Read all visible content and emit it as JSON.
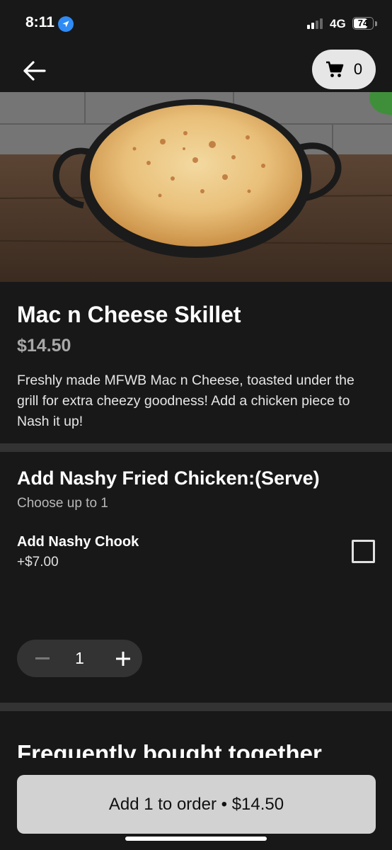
{
  "status": {
    "time": "8:11",
    "network": "4G",
    "battery": "74",
    "battery_level": 0.74
  },
  "header": {
    "back_icon": "arrow-left-icon",
    "cart_icon": "cart-icon",
    "cart_count": "0"
  },
  "product": {
    "image": "mac-n-cheese-skillet-photo",
    "name": "Mac n Cheese Skillet",
    "price": "$14.50",
    "description": "Freshly made MFWB Mac n Cheese, toasted under the grill for extra cheezy goodness! Add a chicken piece to Nash it up!"
  },
  "options": {
    "title": "Add Nashy Fried Chicken:(Serve)",
    "subtitle": "Choose up to 1",
    "items": [
      {
        "label": "Add Nashy Chook",
        "price": "+$7.00",
        "checked": false
      }
    ]
  },
  "quantity": {
    "value": "1",
    "minus_icon": "minus-icon",
    "plus_icon": "plus-icon"
  },
  "section_frequently": {
    "title": "Frequently bought together"
  },
  "footer": {
    "add_button": "Add 1 to order • $14.50"
  }
}
